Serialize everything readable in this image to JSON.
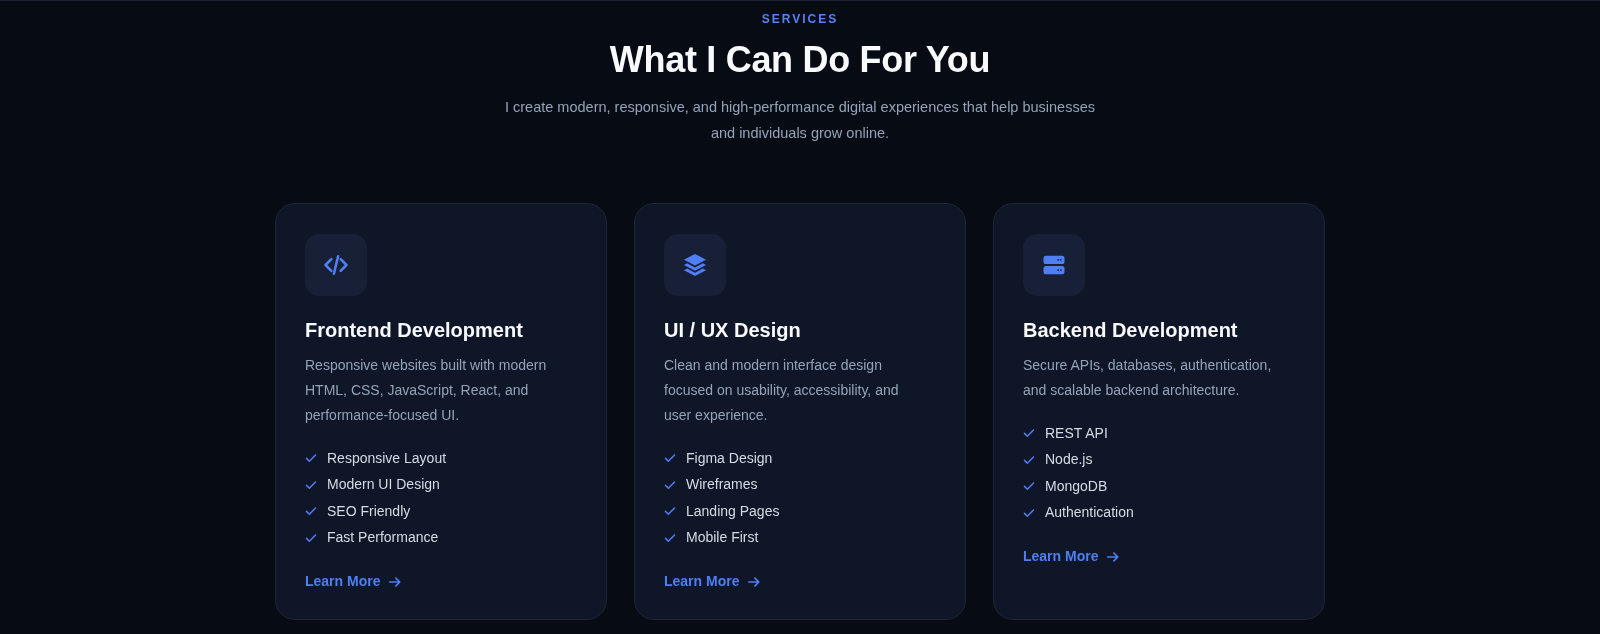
{
  "header": {
    "eyebrow": "SERVICES",
    "title": "What I Can Do For You",
    "subtitle": "I create modern, responsive, and high-performance digital experiences that help businesses and individuals grow online."
  },
  "cards": [
    {
      "kind": "code",
      "title": "Frontend Development",
      "description": "Responsive websites built with modern HTML, CSS, JavaScript, React, and performance-focused UI.",
      "features": [
        "Responsive Layout",
        "Modern UI Design",
        "SEO Friendly",
        "Fast Performance"
      ],
      "link": "Learn More"
    },
    {
      "kind": "layers",
      "title": "UI / UX Design",
      "description": "Clean and modern interface design focused on usability, accessibility, and user experience.",
      "features": [
        "Figma Design",
        "Wireframes",
        "Landing Pages",
        "Mobile First"
      ],
      "link": "Learn More"
    },
    {
      "kind": "server",
      "title": "Backend Development",
      "description": "Secure APIs, databases, authentication, and scalable backend architecture.",
      "features": [
        "REST API",
        "Node.js",
        "MongoDB",
        "Authentication"
      ],
      "link": "Learn More"
    }
  ]
}
